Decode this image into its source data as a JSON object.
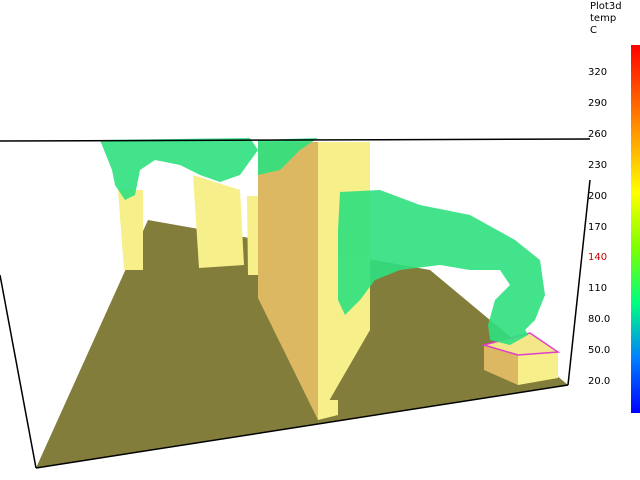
{
  "legend": {
    "title_lines": [
      "Plot3d",
      "temp",
      "C"
    ],
    "ticks": [
      "320",
      "290",
      "260",
      "230",
      "200",
      "170",
      "140",
      "110",
      "80.0",
      "50.0",
      "20.0"
    ],
    "highlight_index": 6,
    "highlight_color": "#cc0000"
  },
  "colors": {
    "floor": "#827d3a",
    "wall_light": "#f6ef8a",
    "wall_dark": "#ddb863",
    "smoke": "#2fe07f",
    "vent_outline": "#e040c8",
    "frame": "#000000",
    "colorbar_top": "#ff0000",
    "colorbar_bottom": "#0000ff"
  }
}
